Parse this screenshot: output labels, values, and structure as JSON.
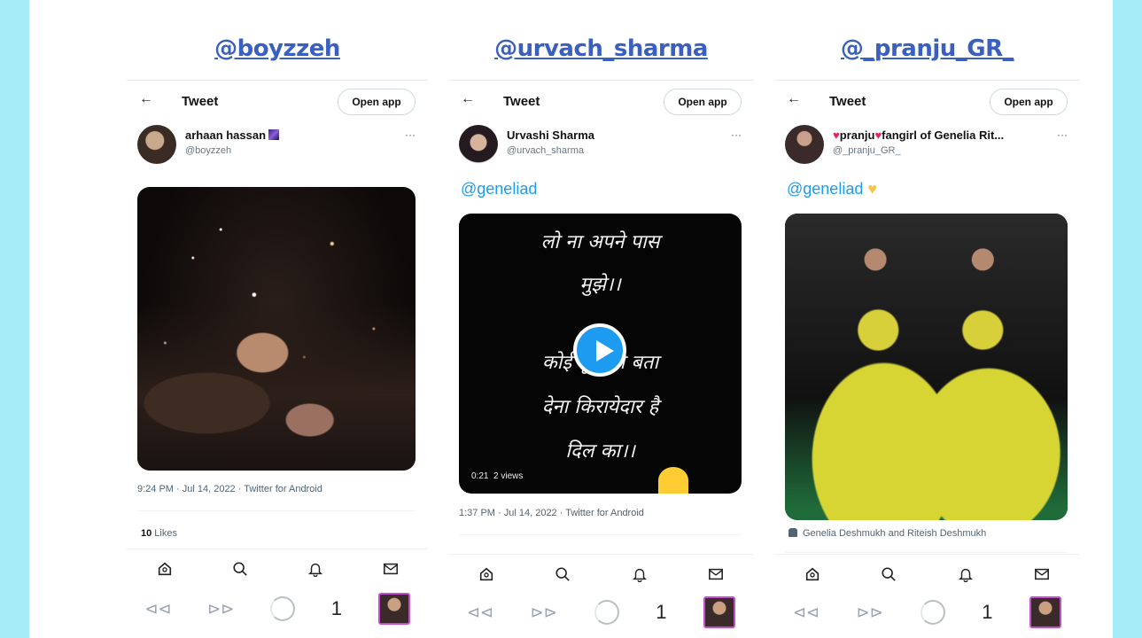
{
  "columns": [
    {
      "title": "@boyzzeh",
      "topbar": {
        "heading": "Tweet",
        "open_app": "Open app"
      },
      "author": {
        "name": "arhaan hassan",
        "handle": "@boyzzeh"
      },
      "timestamp": "9:24 PM · Jul 14, 2022 · Twitter for Android",
      "likes_count": "10",
      "likes_label": " Likes"
    },
    {
      "title": "@urvach_sharma",
      "topbar": {
        "heading": "Tweet",
        "open_app": "Open app"
      },
      "author": {
        "name": "Urvashi Sharma",
        "handle": "@urvach_sharma"
      },
      "mention": "@geneliad",
      "video": {
        "line1": "लो ना अपने पास",
        "line2": "मुझे।।",
        "line3": "कोई  पूछे  तो  बता",
        "line4": "देना किरायेदार है",
        "line5": "दिल का।।",
        "duration": "0:21",
        "views": "2 views"
      },
      "timestamp": "1:37 PM · Jul 14, 2022 · Twitter for Android"
    },
    {
      "title": "@_pranju_GR_",
      "topbar": {
        "heading": "Tweet",
        "open_app": "Open app"
      },
      "author": {
        "name": "pranju",
        "name_mid": "fangirl of Genelia Rit...",
        "handle": "@_pranju_GR_"
      },
      "mention": "@geneliad",
      "tagged": "Genelia Deshmukh and Riteish Deshmukh"
    }
  ],
  "android": {
    "tab_count": "1"
  },
  "icons": [
    "back-arrow-icon",
    "home-icon",
    "search-icon",
    "bell-icon",
    "mail-icon",
    "rewind-icon",
    "forward-icon",
    "loading-icon",
    "play-icon",
    "person-icon",
    "more-icon"
  ]
}
